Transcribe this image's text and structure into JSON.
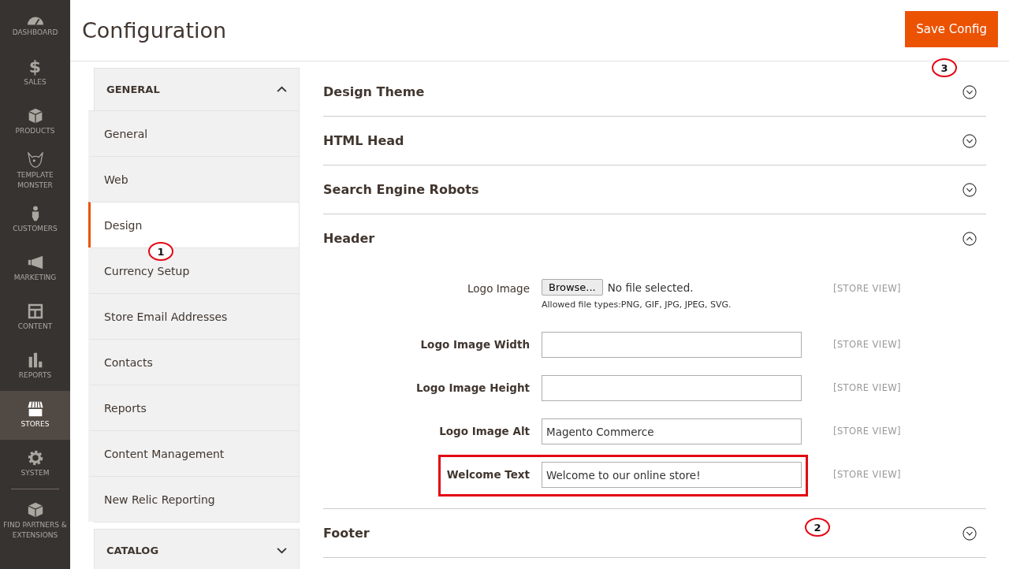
{
  "nav": [
    {
      "label": "DASHBOARD",
      "selected": false
    },
    {
      "glyph": "$",
      "label": "SALES",
      "selected": false
    },
    {
      "label": "PRODUCTS",
      "selected": false
    },
    {
      "label": "TEMPLATE MONSTER",
      "selected": false
    },
    {
      "label": "CUSTOMERS",
      "selected": false
    },
    {
      "label": "MARKETING",
      "selected": false
    },
    {
      "label": "CONTENT",
      "selected": false
    },
    {
      "label": "REPORTS",
      "selected": false
    },
    {
      "label": "STORES",
      "selected": true
    },
    {
      "label": "SYSTEM",
      "selected": false
    },
    {
      "label": "FIND PARTNERS & EXTENSIONS",
      "selected": false
    }
  ],
  "page_title": "Configuration",
  "save_button": "Save Config",
  "config_tabs": [
    {
      "title": "GENERAL",
      "expanded": true,
      "items": [
        {
          "label": "General",
          "selected": false
        },
        {
          "label": "Web",
          "selected": false
        },
        {
          "label": "Design",
          "selected": true
        },
        {
          "label": "Currency Setup",
          "selected": false
        },
        {
          "label": "Store Email Addresses",
          "selected": false
        },
        {
          "label": "Contacts",
          "selected": false
        },
        {
          "label": "Reports",
          "selected": false
        },
        {
          "label": "Content Management",
          "selected": false
        },
        {
          "label": "New Relic Reporting",
          "selected": false
        }
      ]
    },
    {
      "title": "CATALOG",
      "expanded": false
    }
  ],
  "sections": [
    {
      "title": "Design Theme",
      "expanded": false
    },
    {
      "title": "HTML Head",
      "expanded": false
    },
    {
      "title": "Search Engine Robots",
      "expanded": false
    },
    {
      "title": "Header",
      "expanded": true,
      "fields": [
        {
          "kind": "file",
          "label": "Logo Image",
          "button": "Browse...",
          "value": "No file selected.",
          "note": "Allowed file types:PNG, GIF, JPG, JPEG, SVG.",
          "scope": "[STORE VIEW]",
          "highlighted": false
        },
        {
          "kind": "text",
          "label": "Logo Image Width",
          "scope": "[STORE VIEW]",
          "highlighted": false
        },
        {
          "kind": "text",
          "label": "Logo Image Height",
          "scope": "[STORE VIEW]",
          "highlighted": false
        },
        {
          "kind": "text",
          "label": "Logo Image Alt",
          "value": "Magento Commerce",
          "scope": "[STORE VIEW]",
          "highlighted": false
        },
        {
          "kind": "text",
          "label": "Welcome Text",
          "value": "Welcome to our online store!",
          "scope": "[STORE VIEW]",
          "highlighted": true
        }
      ]
    },
    {
      "title": "Footer",
      "expanded": false
    }
  ],
  "annotations": [
    {
      "number": "1"
    },
    {
      "number": "2"
    },
    {
      "number": "3"
    }
  ]
}
